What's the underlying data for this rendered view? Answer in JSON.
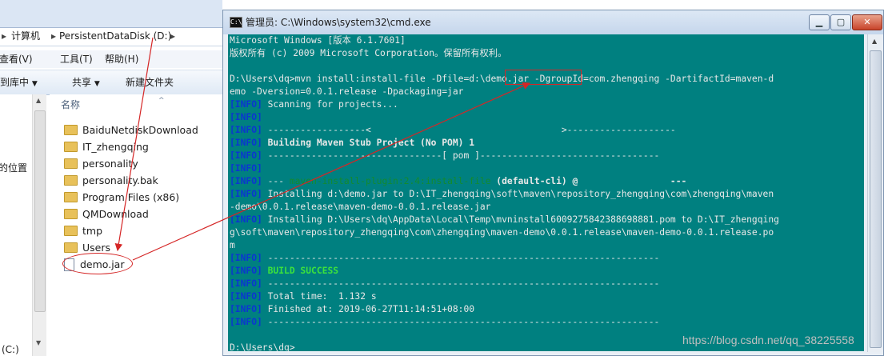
{
  "explorer": {
    "breadcrumb": [
      "计算机",
      "PersistentDataDisk (D:)"
    ],
    "menu": [
      "查看(V)",
      "工具(T)",
      "帮助(H)"
    ],
    "toolbar": [
      "含到库中",
      "共享",
      "新建文件夹"
    ],
    "column_header": "名称",
    "nav_fragment": "的位置",
    "nav_drive": "(C:)",
    "files": [
      {
        "name": "BaiduNetdiskDownload",
        "icon": "folder-icon"
      },
      {
        "name": "IT_zhengqing",
        "icon": "folder-icon"
      },
      {
        "name": "personality",
        "icon": "folder-icon"
      },
      {
        "name": "personality.bak",
        "icon": "folder-icon"
      },
      {
        "name": "Program Files (x86)",
        "icon": "folder-icon"
      },
      {
        "name": "QMDownload",
        "icon": "folder-icon"
      },
      {
        "name": "tmp",
        "icon": "folder-icon"
      },
      {
        "name": "Users",
        "icon": "folder-icon"
      },
      {
        "name": "demo.jar",
        "icon": "jar-file-icon"
      }
    ]
  },
  "cmd": {
    "title": "管理员: C:\\Windows\\system32\\cmd.exe",
    "lines": [
      {
        "text": "Microsoft Windows [版本 6.1.7601]"
      },
      {
        "text": "版权所有 (c) 2009 Microsoft Corporation。保留所有权利。"
      },
      {
        "text": ""
      },
      {
        "text": "D:\\Users\\dq>mvn install:install-file -Dfile=d:\\demo.jar -DgroupId=com.zhengqing -DartifactId=maven-d"
      },
      {
        "text": "emo -Dversion=0.0.1.release -Dpackaging=jar"
      },
      {
        "tag": "[INFO]",
        "text": " Scanning for projects..."
      },
      {
        "tag": "[INFO]",
        "text": ""
      },
      {
        "tag": "[INFO]",
        "text": " ------------------< ",
        "text2": "                                  >--------------------"
      },
      {
        "tag": "[INFO]",
        "text": " Building Maven Stub Project (No POM) 1",
        "style": "bold"
      },
      {
        "tag": "[INFO]",
        "text": " --------------------------------[ pom ]---------------------------------"
      },
      {
        "tag": "[INFO]",
        "text": ""
      },
      {
        "tag": "[INFO]",
        "text": " --- ",
        "plugin": "maven-install-plugin:2.4:install-file",
        "text2": " (default-cli) @                 ---"
      },
      {
        "tag": "[INFO]",
        "text": " Installing d:\\demo.jar to D:\\IT_zhengqing\\soft\\maven\\repository_zhengqing\\com\\zhengqing\\maven"
      },
      {
        "text": "-demo\\0.0.1.release\\maven-demo-0.0.1.release.jar"
      },
      {
        "tag": "[INFO]",
        "text": " Installing D:\\Users\\dq\\AppData\\Local\\Temp\\mvninstall6009275842388698881.pom to D:\\IT_zhengqing"
      },
      {
        "text": "g\\soft\\maven\\repository_zhengqing\\com\\zhengqing\\maven-demo\\0.0.1.release\\maven-demo-0.0.1.release.po"
      },
      {
        "text": "m"
      },
      {
        "tag": "[INFO]",
        "text": " ------------------------------------------------------------------------"
      },
      {
        "tag": "[INFO]",
        "text": " ",
        "success": "BUILD SUCCESS"
      },
      {
        "tag": "[INFO]",
        "text": " ------------------------------------------------------------------------"
      },
      {
        "tag": "[INFO]",
        "text": " Total time:  1.132 s"
      },
      {
        "tag": "[INFO]",
        "text": " Finished at: 2019-06-27T11:14:51+08:00"
      },
      {
        "tag": "[INFO]",
        "text": " ------------------------------------------------------------------------"
      },
      {
        "text": ""
      },
      {
        "text": "D:\\Users\\dq>"
      }
    ]
  },
  "watermark": "https://blog.csdn.net/qq_38225558",
  "colors": {
    "console_bg": "#008080",
    "annotation": "#d52626",
    "info_tag": "#0b36d0",
    "success": "#3ce23c"
  }
}
